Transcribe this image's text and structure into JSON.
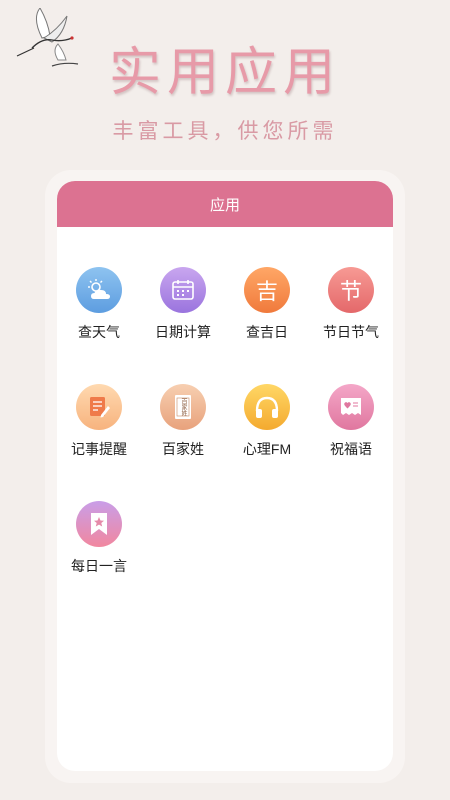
{
  "header": {
    "headline": "实用应用",
    "tagline": "丰富工具，供您所需"
  },
  "card": {
    "title": "应用"
  },
  "apps": [
    {
      "label": "查天气",
      "icon": "weather-icon"
    },
    {
      "label": "日期计算",
      "icon": "calendar-icon"
    },
    {
      "label": "查吉日",
      "icon": "lucky-day-icon",
      "glyph": "吉"
    },
    {
      "label": "节日节气",
      "icon": "festival-icon",
      "glyph": "节"
    },
    {
      "label": "记事提醒",
      "icon": "notepad-icon"
    },
    {
      "label": "百家姓",
      "icon": "surname-book-icon",
      "glyph": "百家姓"
    },
    {
      "label": "心理FM",
      "icon": "headphones-icon"
    },
    {
      "label": "祝福语",
      "icon": "greeting-card-icon"
    },
    {
      "label": "每日一言",
      "icon": "bookmark-star-icon"
    }
  ],
  "colors": {
    "header_bar": "#dc7291",
    "headline": "#e79aa8",
    "background": "#f3eeeb"
  }
}
